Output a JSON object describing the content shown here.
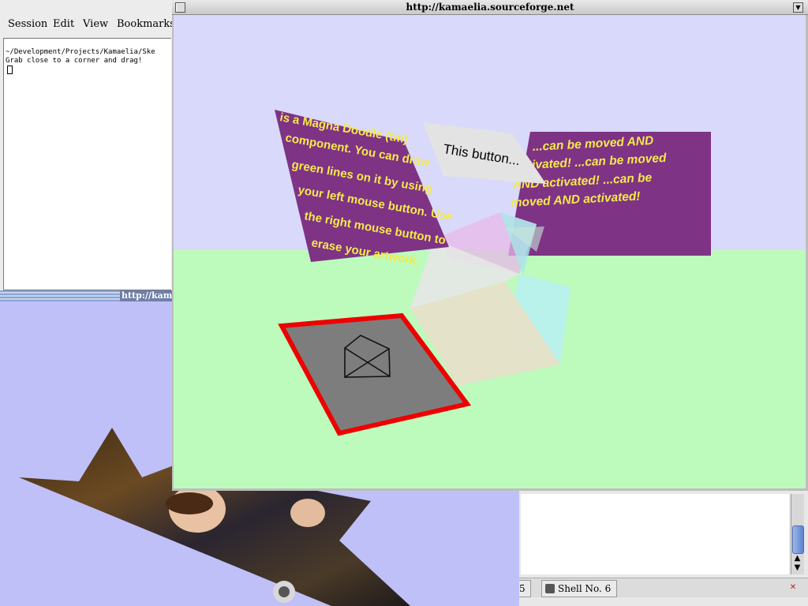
{
  "terminal": {
    "menu": [
      "Session",
      "Edit",
      "View",
      "Bookmarks"
    ],
    "lines": [
      "~/Development/Projects/Kamaelia/Ske",
      "Grab close to a corner and drag!"
    ]
  },
  "window2": {
    "title": "http://kama"
  },
  "browser": {
    "title": "http://kamaelia.sourceforge.net"
  },
  "scene": {
    "left_panel_lines": [
      "is a Magna Doodle (tm)",
      "component. You can draw",
      "green lines on it by using",
      "your left mouse button. Use",
      "the right mouse button to",
      "erase your artwork."
    ],
    "button_label": "This button...",
    "right_panel_lines": [
      "...can be moved AND",
      "activated! ...can be moved",
      "AND activated! ...can be",
      "moved AND activated!"
    ],
    "colors": {
      "sky": "#d9d9fb",
      "ground": "#bdfbbd",
      "panel": "#7e3385",
      "panel_text": "#f4e94a",
      "red_frame": "#ee0000"
    }
  },
  "taskbar": {
    "tab_prev": "5",
    "tab_active": "Shell No. 6"
  },
  "icons": [
    "window-menu-icon",
    "window-close-icon",
    "scroll-up-icon",
    "scroll-down-icon",
    "shell-tab-icon",
    "close-tab-icon"
  ]
}
